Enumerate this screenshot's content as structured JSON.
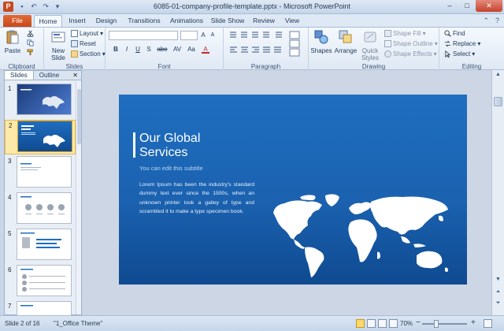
{
  "window": {
    "title": "6085-01-company-profile-template.pptx - Microsoft PowerPoint",
    "app_logo_letter": "P",
    "controls": {
      "minimize": "–",
      "maximize": "□",
      "close": "✕"
    }
  },
  "tabs": [
    "File",
    "Home",
    "Insert",
    "Design",
    "Transitions",
    "Animations",
    "Slide Show",
    "Review",
    "View"
  ],
  "active_tab": "Home",
  "ribbon": {
    "clipboard": {
      "paste": "Paste",
      "label": "Clipboard"
    },
    "slides": {
      "new_slide_line1": "New",
      "new_slide_line2": "Slide",
      "layout": "Layout",
      "reset": "Reset",
      "section": "Section",
      "label": "Slides"
    },
    "font": {
      "label": "Font",
      "buttons": [
        "B",
        "I",
        "U",
        "S",
        "abe",
        "AV",
        "Aa",
        "A"
      ]
    },
    "paragraph": {
      "label": "Paragraph"
    },
    "drawing": {
      "shapes": "Shapes",
      "arrange": "Arrange",
      "quick_styles_line1": "Quick",
      "quick_styles_line2": "Styles",
      "shape_fill": "Shape Fill",
      "shape_outline": "Shape Outline",
      "shape_effects": "Shape Effects",
      "label": "Drawing"
    },
    "editing": {
      "find": "Find",
      "replace": "Replace",
      "select": "Select",
      "label": "Editing"
    }
  },
  "pane": {
    "tabs": [
      "Slides",
      "Outline"
    ],
    "close": "✕",
    "thumbnails": [
      "1",
      "2",
      "3",
      "4",
      "5",
      "6",
      "7"
    ],
    "selected": 2
  },
  "slide": {
    "title": "Our Global Services",
    "subtitle": "You can edit this subtitle",
    "body": "Lorem Ipsum has been the industry's standard dummy text ever since the 1500s, when an unknown printer took a galley of type and scrambled it to make a type specimen book."
  },
  "status": {
    "slide_info": "Slide 2 of 16",
    "theme": "\"1_Office Theme\"",
    "zoom": "70%"
  },
  "colors": {
    "slide_blue": "#1f6ec0",
    "file_tab": "#d35a26",
    "accent": "#fbd76c"
  }
}
